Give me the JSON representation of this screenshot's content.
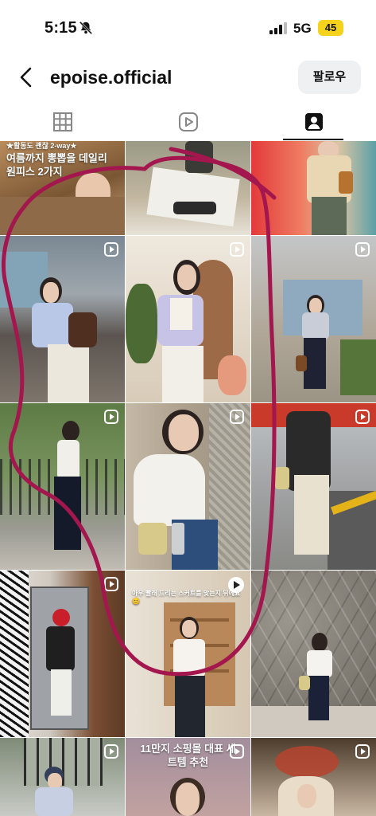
{
  "status_bar": {
    "time": "5:15",
    "network": "5G",
    "battery": "45"
  },
  "header": {
    "username": "epoise.official",
    "follow_label": "팔로우"
  },
  "tabs": [
    {
      "name": "posts",
      "icon": "grid-icon"
    },
    {
      "name": "reels",
      "icon": "reels-icon"
    },
    {
      "name": "tagged",
      "icon": "tagged-icon",
      "selected": true
    }
  ],
  "posts": [
    {
      "caption_top": "★활동도 괜찮 2-way★",
      "caption": "여름까지 뽕뽑을 데일리 원피스 2가지"
    },
    {
      "caption": ""
    },
    {
      "caption": ""
    },
    {
      "caption": ""
    },
    {
      "caption": ""
    },
    {
      "caption": ""
    },
    {
      "caption": ""
    },
    {
      "caption": ""
    },
    {
      "caption": ""
    },
    {
      "caption": ""
    },
    {
      "caption": "아우 빨래 드리는 스커트를 맞는지 뒤에요 😊"
    },
    {
      "caption": ""
    },
    {
      "caption": ""
    },
    {
      "caption": "11만지 소핑몰 대표 세트템 추천"
    },
    {
      "caption": ""
    }
  ],
  "colors": {
    "annotation_stroke": "#a3164e",
    "battery": "#f5d21c"
  }
}
